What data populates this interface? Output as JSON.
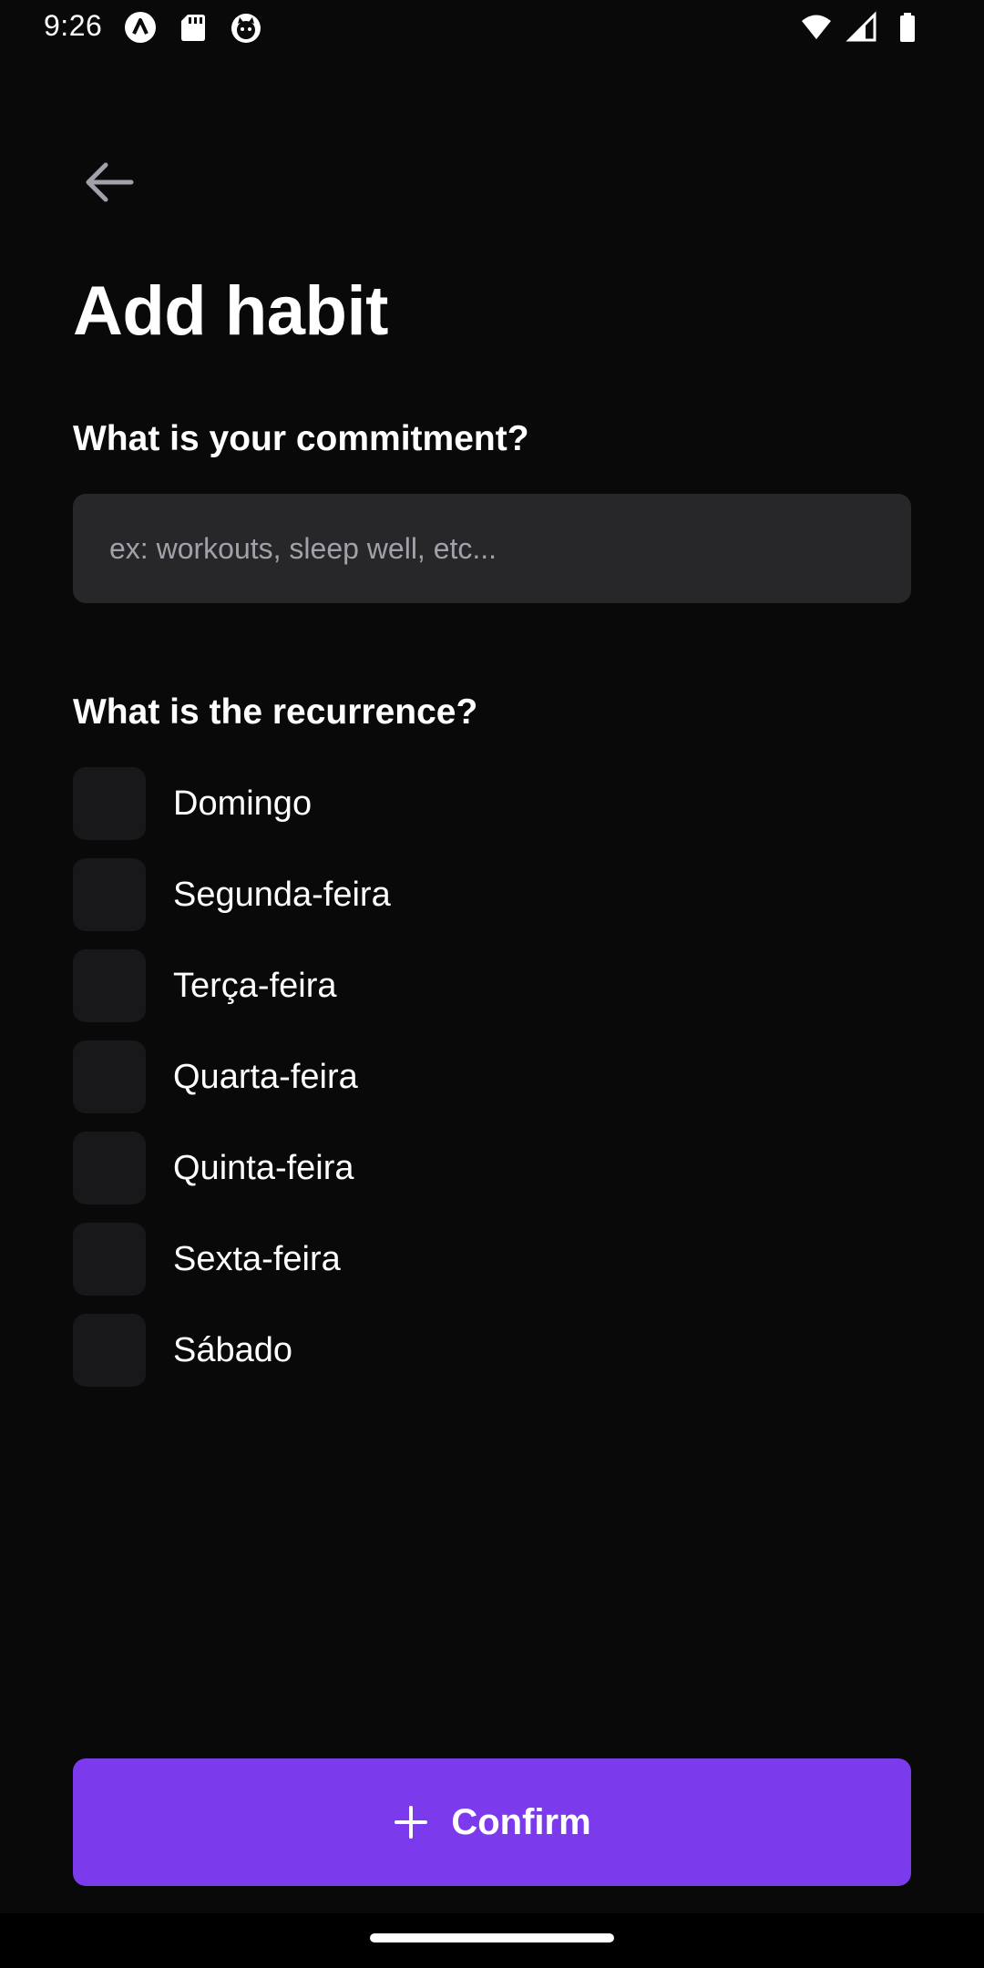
{
  "status_bar": {
    "time": "9:26",
    "left_icons": [
      "app-a-icon",
      "sd-card-icon",
      "cat-face-icon"
    ],
    "right_icons": [
      "wifi-icon",
      "cell-signal-icon",
      "battery-icon"
    ]
  },
  "header": {
    "back_icon": "arrow-left-icon",
    "title": "Add habit"
  },
  "commitment": {
    "label": "What is your commitment?",
    "value": "",
    "placeholder": "ex: workouts, sleep well, etc..."
  },
  "recurrence": {
    "label": "What is the recurrence?",
    "days": [
      {
        "label": "Domingo",
        "checked": false
      },
      {
        "label": "Segunda-feira",
        "checked": false
      },
      {
        "label": "Terça-feira",
        "checked": false
      },
      {
        "label": "Quarta-feira",
        "checked": false
      },
      {
        "label": "Quinta-feira",
        "checked": false
      },
      {
        "label": "Sexta-feira",
        "checked": false
      },
      {
        "label": "Sábado",
        "checked": false
      }
    ]
  },
  "confirm": {
    "icon": "plus-icon",
    "label": "Confirm"
  },
  "colors": {
    "background": "#09090a",
    "input_bg": "#27272a",
    "checkbox_bg": "#18181b",
    "accent": "#7c3aed",
    "placeholder": "#a1a1aa"
  }
}
